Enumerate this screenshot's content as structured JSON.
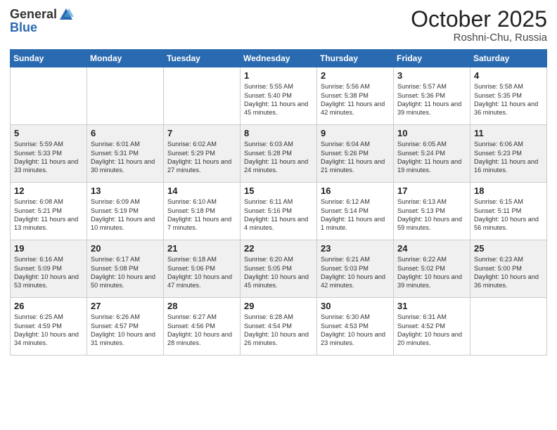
{
  "header": {
    "logo_general": "General",
    "logo_blue": "Blue",
    "month_title": "October 2025",
    "location": "Roshni-Chu, Russia"
  },
  "days_of_week": [
    "Sunday",
    "Monday",
    "Tuesday",
    "Wednesday",
    "Thursday",
    "Friday",
    "Saturday"
  ],
  "weeks": [
    [
      {
        "day": "",
        "text": ""
      },
      {
        "day": "",
        "text": ""
      },
      {
        "day": "",
        "text": ""
      },
      {
        "day": "1",
        "text": "Sunrise: 5:55 AM\nSunset: 5:40 PM\nDaylight: 11 hours and 45 minutes."
      },
      {
        "day": "2",
        "text": "Sunrise: 5:56 AM\nSunset: 5:38 PM\nDaylight: 11 hours and 42 minutes."
      },
      {
        "day": "3",
        "text": "Sunrise: 5:57 AM\nSunset: 5:36 PM\nDaylight: 11 hours and 39 minutes."
      },
      {
        "day": "4",
        "text": "Sunrise: 5:58 AM\nSunset: 5:35 PM\nDaylight: 11 hours and 36 minutes."
      }
    ],
    [
      {
        "day": "5",
        "text": "Sunrise: 5:59 AM\nSunset: 5:33 PM\nDaylight: 11 hours and 33 minutes."
      },
      {
        "day": "6",
        "text": "Sunrise: 6:01 AM\nSunset: 5:31 PM\nDaylight: 11 hours and 30 minutes."
      },
      {
        "day": "7",
        "text": "Sunrise: 6:02 AM\nSunset: 5:29 PM\nDaylight: 11 hours and 27 minutes."
      },
      {
        "day": "8",
        "text": "Sunrise: 6:03 AM\nSunset: 5:28 PM\nDaylight: 11 hours and 24 minutes."
      },
      {
        "day": "9",
        "text": "Sunrise: 6:04 AM\nSunset: 5:26 PM\nDaylight: 11 hours and 21 minutes."
      },
      {
        "day": "10",
        "text": "Sunrise: 6:05 AM\nSunset: 5:24 PM\nDaylight: 11 hours and 19 minutes."
      },
      {
        "day": "11",
        "text": "Sunrise: 6:06 AM\nSunset: 5:23 PM\nDaylight: 11 hours and 16 minutes."
      }
    ],
    [
      {
        "day": "12",
        "text": "Sunrise: 6:08 AM\nSunset: 5:21 PM\nDaylight: 11 hours and 13 minutes."
      },
      {
        "day": "13",
        "text": "Sunrise: 6:09 AM\nSunset: 5:19 PM\nDaylight: 11 hours and 10 minutes."
      },
      {
        "day": "14",
        "text": "Sunrise: 6:10 AM\nSunset: 5:18 PM\nDaylight: 11 hours and 7 minutes."
      },
      {
        "day": "15",
        "text": "Sunrise: 6:11 AM\nSunset: 5:16 PM\nDaylight: 11 hours and 4 minutes."
      },
      {
        "day": "16",
        "text": "Sunrise: 6:12 AM\nSunset: 5:14 PM\nDaylight: 11 hours and 1 minute."
      },
      {
        "day": "17",
        "text": "Sunrise: 6:13 AM\nSunset: 5:13 PM\nDaylight: 10 hours and 59 minutes."
      },
      {
        "day": "18",
        "text": "Sunrise: 6:15 AM\nSunset: 5:11 PM\nDaylight: 10 hours and 56 minutes."
      }
    ],
    [
      {
        "day": "19",
        "text": "Sunrise: 6:16 AM\nSunset: 5:09 PM\nDaylight: 10 hours and 53 minutes."
      },
      {
        "day": "20",
        "text": "Sunrise: 6:17 AM\nSunset: 5:08 PM\nDaylight: 10 hours and 50 minutes."
      },
      {
        "day": "21",
        "text": "Sunrise: 6:18 AM\nSunset: 5:06 PM\nDaylight: 10 hours and 47 minutes."
      },
      {
        "day": "22",
        "text": "Sunrise: 6:20 AM\nSunset: 5:05 PM\nDaylight: 10 hours and 45 minutes."
      },
      {
        "day": "23",
        "text": "Sunrise: 6:21 AM\nSunset: 5:03 PM\nDaylight: 10 hours and 42 minutes."
      },
      {
        "day": "24",
        "text": "Sunrise: 6:22 AM\nSunset: 5:02 PM\nDaylight: 10 hours and 39 minutes."
      },
      {
        "day": "25",
        "text": "Sunrise: 6:23 AM\nSunset: 5:00 PM\nDaylight: 10 hours and 36 minutes."
      }
    ],
    [
      {
        "day": "26",
        "text": "Sunrise: 6:25 AM\nSunset: 4:59 PM\nDaylight: 10 hours and 34 minutes."
      },
      {
        "day": "27",
        "text": "Sunrise: 6:26 AM\nSunset: 4:57 PM\nDaylight: 10 hours and 31 minutes."
      },
      {
        "day": "28",
        "text": "Sunrise: 6:27 AM\nSunset: 4:56 PM\nDaylight: 10 hours and 28 minutes."
      },
      {
        "day": "29",
        "text": "Sunrise: 6:28 AM\nSunset: 4:54 PM\nDaylight: 10 hours and 26 minutes."
      },
      {
        "day": "30",
        "text": "Sunrise: 6:30 AM\nSunset: 4:53 PM\nDaylight: 10 hours and 23 minutes."
      },
      {
        "day": "31",
        "text": "Sunrise: 6:31 AM\nSunset: 4:52 PM\nDaylight: 10 hours and 20 minutes."
      },
      {
        "day": "",
        "text": ""
      }
    ]
  ]
}
